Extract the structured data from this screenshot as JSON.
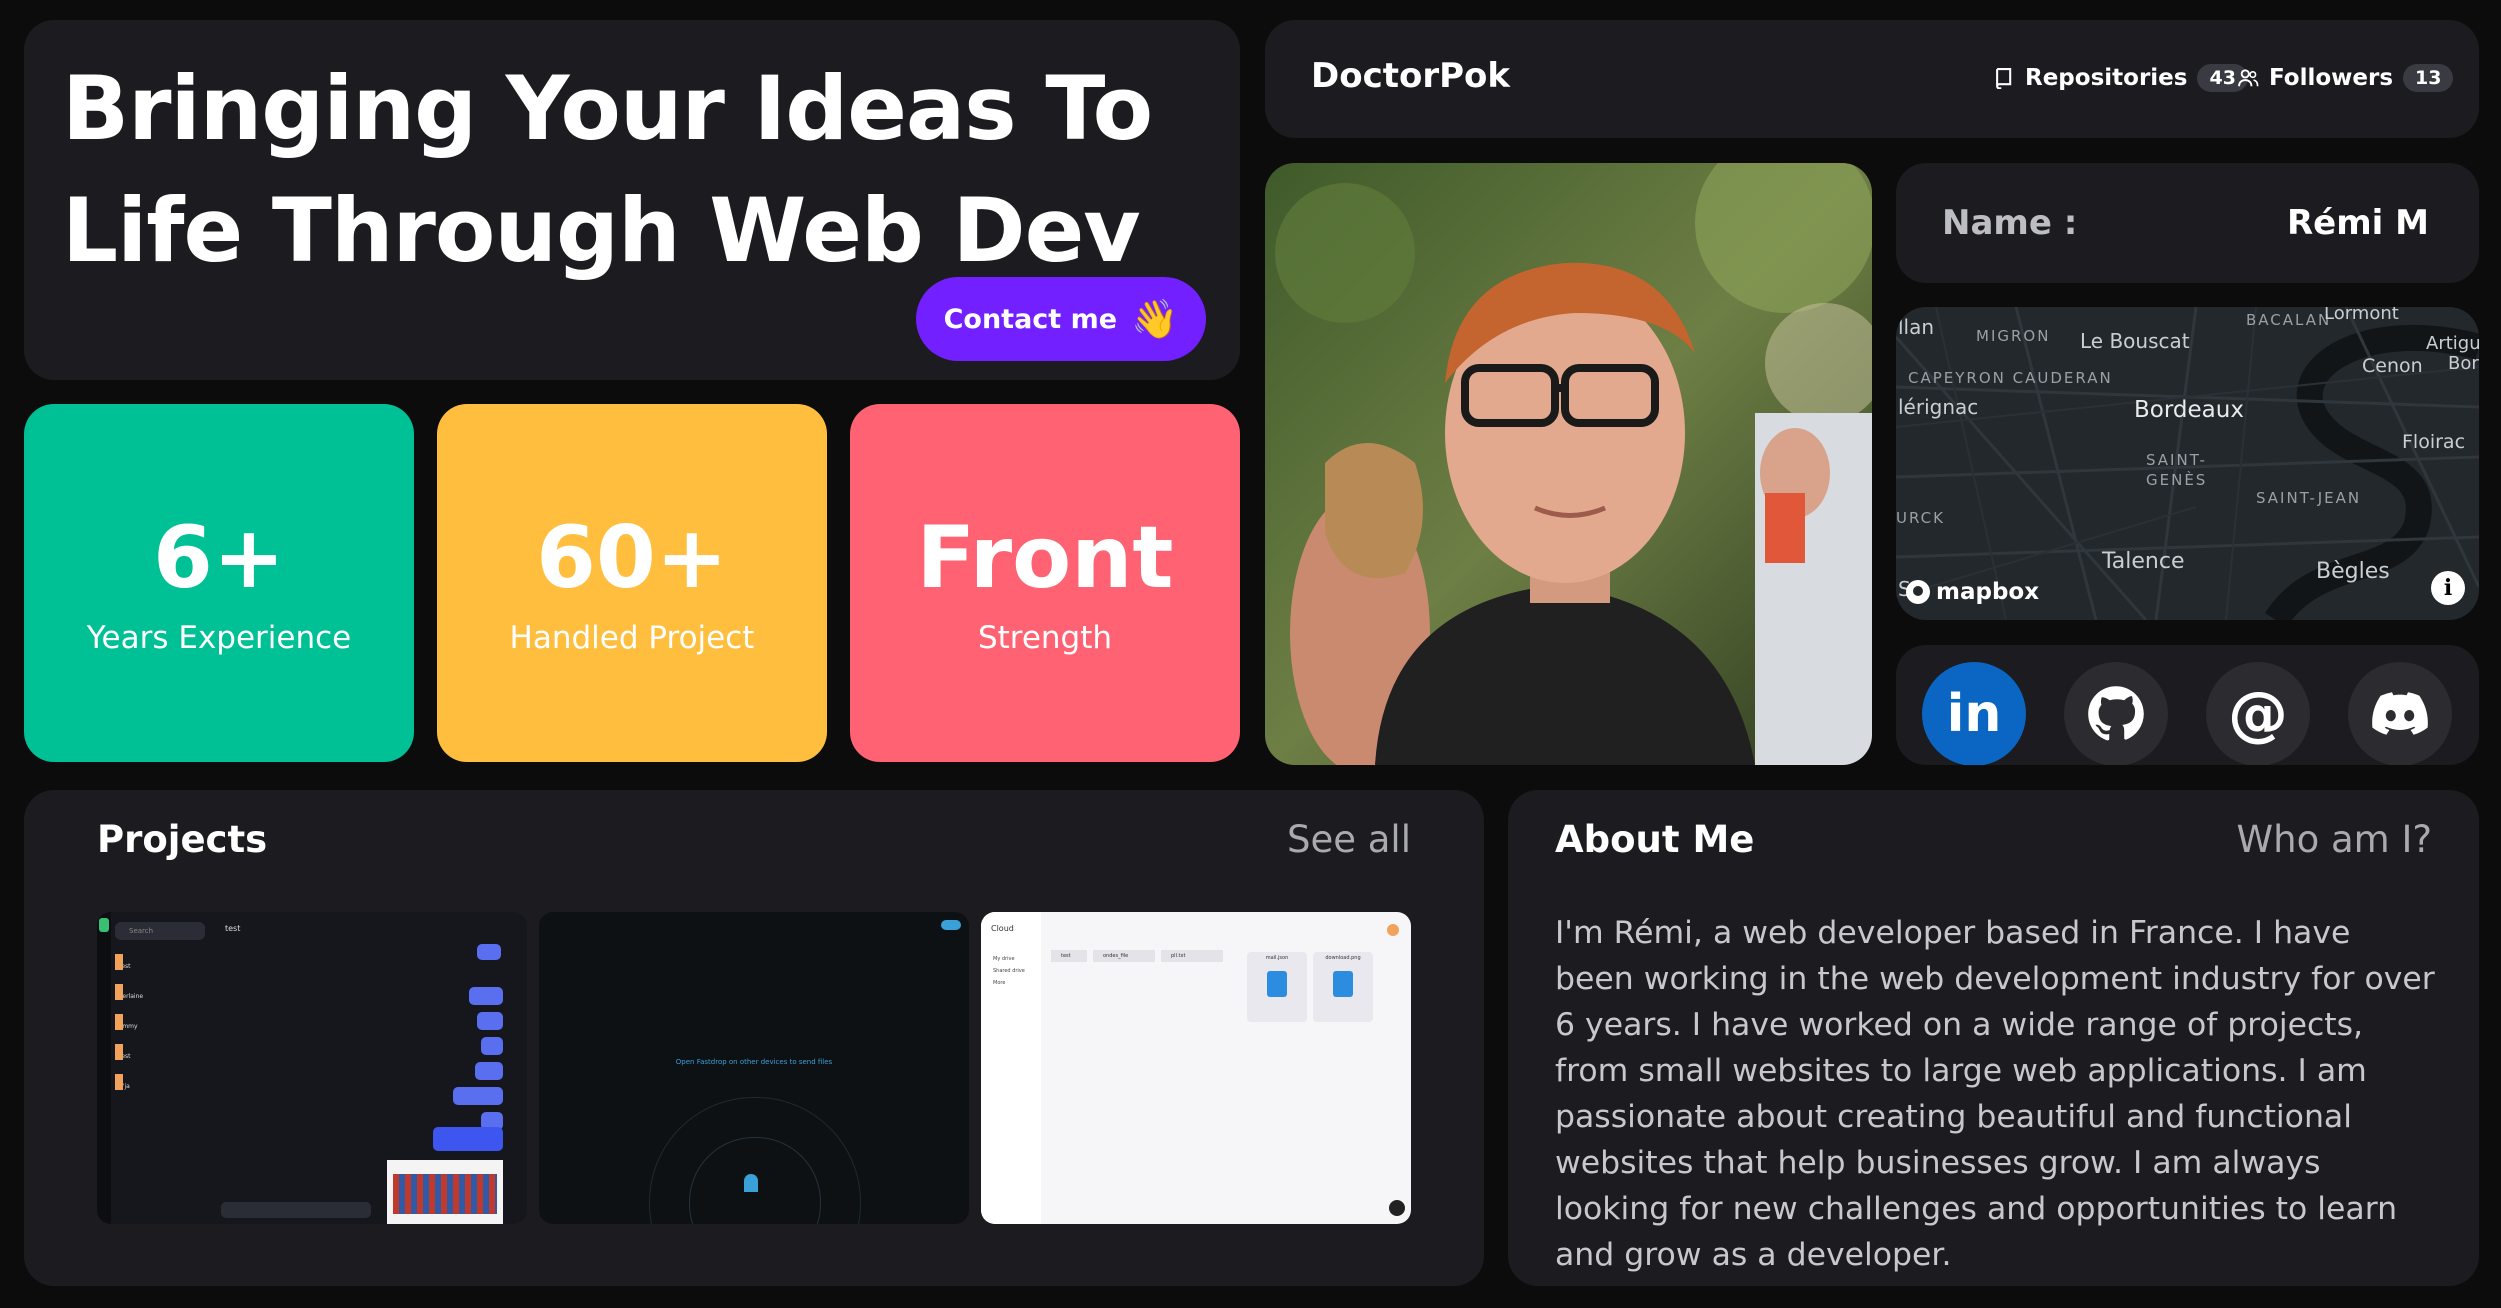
{
  "hero": {
    "title": "Bringing Your Ideas To Life Through Web Dev",
    "contact_label": "Contact me",
    "contact_icon": "waving-hand-icon"
  },
  "stats": [
    {
      "value": "6+",
      "label": "Years Experience",
      "color": "#00c096"
    },
    {
      "value": "60+",
      "label": "Handled Project",
      "color": "#ffbe3d"
    },
    {
      "value": "Front",
      "label": "Strength",
      "color": "#ff6373"
    }
  ],
  "github": {
    "username": "DoctorPok",
    "repos_label": "Repositories",
    "repos_count": "43",
    "followers_label": "Followers",
    "followers_count": "13"
  },
  "profile": {
    "name_label": "Name :",
    "name_value": "Rémi M"
  },
  "map": {
    "labels": [
      "llan",
      "MIGRON",
      "Le Bouscat",
      "BACALAN",
      "Lormont",
      "Artigue",
      "Bord",
      "CAPEYRON CAUDERAN",
      "Cenon",
      "lérignac",
      "Bordeaux",
      "Floirac",
      "SAINT-",
      "GENÈS",
      "SAINT-JEAN",
      "URCK",
      "Talence",
      "Bègles",
      "S"
    ],
    "attribution": "mapbox"
  },
  "social": [
    {
      "name": "linkedin",
      "icon": "linkedin-icon",
      "glyph": "in",
      "color": "#0a66c2"
    },
    {
      "name": "github",
      "icon": "github-icon",
      "color": "#2b2b30"
    },
    {
      "name": "email",
      "icon": "at-icon",
      "glyph": "@",
      "color": "#2b2b30"
    },
    {
      "name": "discord",
      "icon": "discord-icon",
      "color": "#2b2b30"
    }
  ],
  "projects": {
    "title": "Projects",
    "see_all": "See all",
    "items": [
      {
        "name": "chat-app",
        "search": "Search",
        "header": "test",
        "contacts": [
          "test",
          "Perlaine",
          "jimmy",
          "test",
          "n'ja"
        ]
      },
      {
        "name": "file-share-app",
        "caption": "Open Fastdrop on other devices to send files"
      },
      {
        "name": "cloud-app",
        "brand": "Cloud",
        "nav": [
          "My drive",
          "Shared drive",
          "More"
        ],
        "folders": [
          "test",
          "ondes_file",
          "pll.txt"
        ],
        "files": [
          "mail.json",
          "download.png"
        ]
      }
    ]
  },
  "about": {
    "title": "About Me",
    "subtitle": "Who am I?",
    "text": "I'm Rémi, a web developer based in France. I have been working in the web development industry for over 6 years. I have worked on a wide range of projects, from small websites to large web applications. I am passionate about creating beautiful and functional websites that help businesses grow. I am always looking for new challenges and opportunities to learn and grow as a developer."
  }
}
